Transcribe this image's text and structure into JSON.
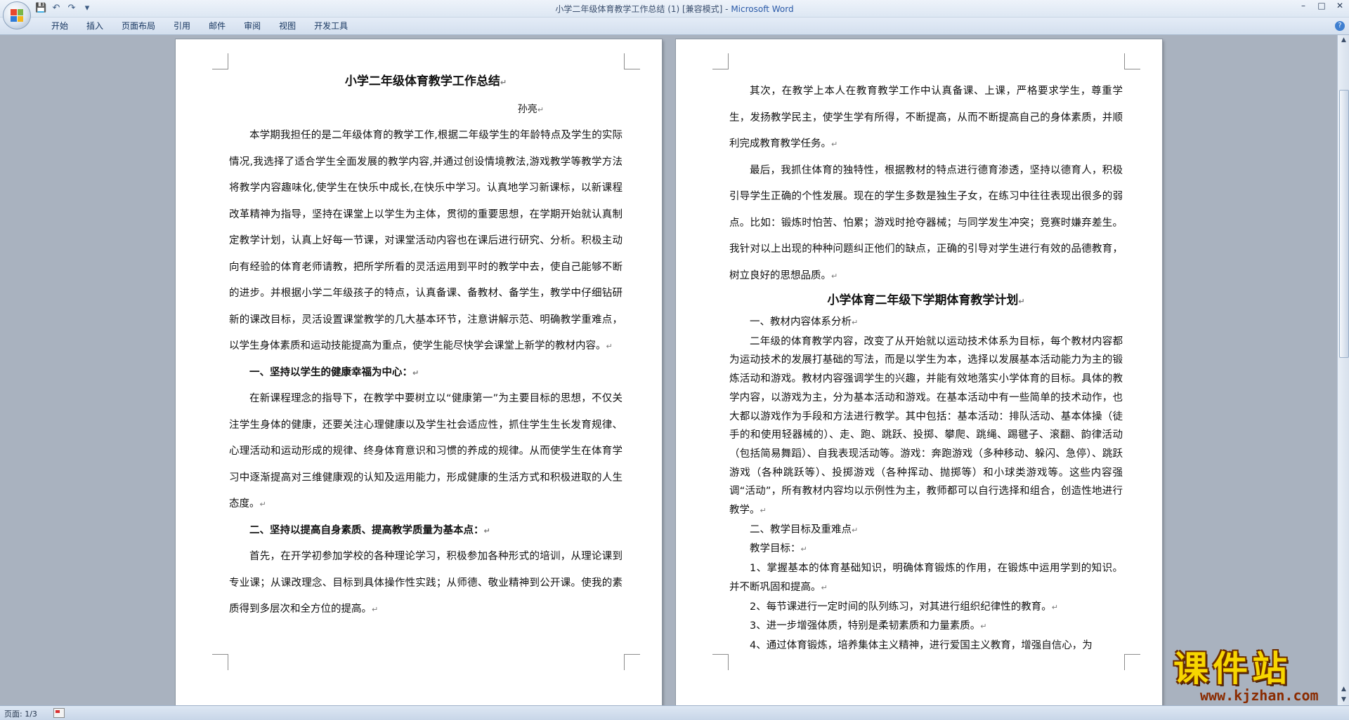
{
  "window": {
    "title": "小学二年级体育教学工作总结 (1) [兼容模式] - ",
    "app_name": "Microsoft Word",
    "minimize": "–",
    "maximize": "□",
    "close": "✕"
  },
  "quick_access": {
    "save_icon": "💾",
    "undo_icon": "↶",
    "redo_icon": "↷",
    "more_icon": "▾"
  },
  "ribbon": {
    "tabs": [
      "开始",
      "插入",
      "页面布局",
      "引用",
      "邮件",
      "审阅",
      "视图",
      "开发工具"
    ],
    "help": "?"
  },
  "page_left": {
    "title": "小学二年级体育教学工作总结",
    "author": "孙亮",
    "paragraphs": [
      "本学期我担任的是二年级体育的教学工作,根据二年级学生的年龄特点及学生的实际情况,我选择了适合学生全面发展的教学内容,并通过创设情境教法,游戏教学等教学方法将教学内容趣味化,使学生在快乐中成长,在快乐中学习。认真地学习新课标，以新课程改革精神为指导，坚持在课堂上以学生为主体，贯彻的重要思想，在学期开始就认真制定教学计划，认真上好每一节课，对课堂活动内容也在课后进行研究、分析。积极主动向有经验的体育老师请教，把所学所看的灵活运用到平时的教学中去，使自己能够不断的进步。并根据小学二年级孩子的特点，认真备课、备教材、备学生，教学中仔细钻研新的课改目标，灵活设置课堂教学的几大基本环节，注意讲解示范、明确教学重难点，以学生身体素质和运动技能提高为重点，使学生能尽快学会课堂上新学的教材内容。",
      "一、坚持以学生的健康幸福为中心：",
      "在新课程理念的指导下，在教学中要树立以“健康第一”为主要目标的思想，不仅关注学生身体的健康，还要关注心理健康以及学生社会适应性，抓住学生生长发育规律、心理活动和运动形成的规律、终身体育意识和习惯的养成的规律。从而使学生在体育学习中逐渐提高对三维健康观的认知及运用能力，形成健康的生活方式和积极进取的人生态度。",
      "二、坚持以提高自身素质、提高教学质量为基本点：",
      "首先，在开学初参加学校的各种理论学习，积极参加各种形式的培训，从理论课到专业课；从课改理念、目标到具体操作性实践；从师德、敬业精神到公开课。使我的素质得到多层次和全方位的提高。"
    ]
  },
  "page_right": {
    "paragraphs": [
      "其次，在教学上本人在教育教学工作中认真备课、上课，严格要求学生，尊重学生，发扬教学民主，使学生学有所得，不断提高，从而不断提高自己的身体素质，并顺利完成教育教学任务。",
      "最后，我抓住体育的独特性，根据教材的特点进行德育渗透，坚持以德育人，积极引导学生正确的个性发展。现在的学生多数是独生子女，在练习中往往表现出很多的弱点。比如：锻炼时怕苦、怕累；游戏时抢夺器械；与同学发生冲突；竞赛时嫌弃差生。我针对以上出现的种种问题纠正他们的缺点，正确的引导对学生进行有效的品德教育，树立良好的思想品质。"
    ],
    "heading": "小学体育二年级下学期体育教学计划",
    "dense_paragraphs": [
      "一、教材内容体系分析",
      "二年级的体育教学内容，改变了从开始就以运动技术体系为目标，每个教材内容都为运动技术的发展打基础的写法，而是以学生为本，选择以发展基本活动能力为主的锻炼活动和游戏。教材内容强调学生的兴趣，并能有效地落实小学体育的目标。具体的教学内容，以游戏为主，分为基本活动和游戏。在基本活动中有一些简单的技术动作，也大都以游戏作为手段和方法进行教学。其中包括：基本活动：排队活动、基本体操（徒手的和使用轻器械的）、走、跑、跳跃、投掷、攀爬、跳绳、踢毽子、滚翻、韵律活动（包括简易舞蹈）、自我表现活动等。游戏：奔跑游戏（多种移动、躲闪、急停）、跳跃游戏（各种跳跃等）、投掷游戏（各种挥动、抛掷等）和小球类游戏等。这些内容强调“活动”，所有教材内容均以示例性为主，教师都可以自行选择和组合，创造性地进行教学。",
      "二、教学目标及重难点",
      "教学目标：",
      "1、掌握基本的体育基础知识，明确体育锻炼的作用，在锻炼中运用学到的知识。并不断巩固和提高。",
      "2、每节课进行一定时间的队列练习，对其进行组织纪律性的教育。",
      "3、进一步增强体质，特别是柔韧素质和力量素质。",
      "4、通过体育锻炼，培养集体主义精神，进行爱国主义教育，增强自信心，为"
    ]
  },
  "paragraph_mark": "↵",
  "status_bar": {
    "page": "页面: 1/3"
  },
  "watermark": {
    "text": "课件站",
    "url": "www.kjzhan.com"
  },
  "colors": {
    "workspace": "#a9b2bf",
    "ribbon": "#d3dfee",
    "app_name": "#2a5aa8",
    "watermark_yellow": "#f7d600"
  }
}
